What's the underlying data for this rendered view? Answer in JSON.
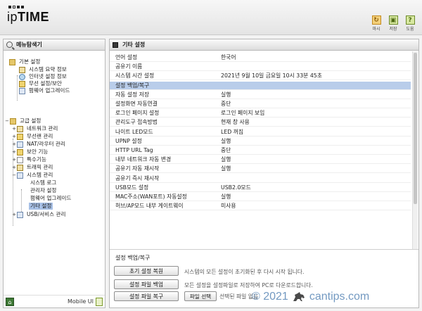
{
  "header": {
    "logo_text_ip": "ip",
    "logo_text_time": "TIME",
    "buttons": [
      {
        "label": "마시",
        "icon": "restart-icon",
        "color": "#f3d07a"
      },
      {
        "label": "저장",
        "icon": "save-icon",
        "color": "#d7e8a0"
      },
      {
        "label": "도움",
        "icon": "help-icon",
        "color": "#d7e8a0"
      }
    ]
  },
  "left": {
    "title": "메뉴탐색기",
    "tree": {
      "basic_settings": "기본 설정",
      "basic_items": [
        "시스템 요약 정보",
        "인터넷 설정 정보",
        "무선 설정/보안",
        "펌웨어 업그레이드"
      ],
      "advanced_settings": "고급 설정",
      "advanced_items": [
        "네트워크 관리",
        "무선랜 관리",
        "NAT/라우터 관리",
        "보안 기능",
        "특수기능",
        "트래픽 관리",
        "시스템 관리"
      ],
      "system_items": [
        "시스템 로그",
        "관리자 설정",
        "펌웨어 업그레이드",
        "기타 설정"
      ],
      "usb_item": "USB/서비스 관리"
    },
    "footer_label": "Mobile UI"
  },
  "right": {
    "title": "기타 설정",
    "settings": [
      {
        "key": "언어 설정",
        "value": "한국어"
      },
      {
        "key": "공유기 이름",
        "value": ""
      },
      {
        "key": "시스템 시간 설정",
        "value": "2021년 9월 10일 금요일 10시 33분 45초"
      },
      {
        "key": "설정 백업/복구",
        "value": "",
        "selected": true
      },
      {
        "key": "자동 설정 저장",
        "value": "실행"
      },
      {
        "key": "설정화면 자동연결",
        "value": "중단"
      },
      {
        "key": "로그인 페이지 설정",
        "value": "로그인 페이지 보임"
      },
      {
        "key": "관리도구 접속방법",
        "value": "현재 창 사용"
      },
      {
        "key": "나이트 LED모드",
        "value": "LED 꺼짐"
      },
      {
        "key": "UPNP 설정",
        "value": "실행"
      },
      {
        "key": "HTTP URL Tag",
        "value": "중단"
      },
      {
        "key": "내부 네트워크 자동 변경",
        "value": "실행"
      },
      {
        "key": "공유기 자동 재시작",
        "value": "실행"
      },
      {
        "key": "공유기 즉시 재시작",
        "value": ""
      },
      {
        "key": "USB모드 설정",
        "value": "USB2.0모드"
      },
      {
        "key": "MAC주소(WAN포트) 자동설정",
        "value": "실행"
      },
      {
        "key": "허브/AP모드 내부 게이트웨이",
        "value": "미사용"
      }
    ],
    "section_title": "설정 백업/복구",
    "actions": [
      {
        "label": "초기 설정 복원",
        "desc": "시스템의 모든 설정이 초기화된 후 다시 시작 됩니다."
      },
      {
        "label": "설정 파일 백업",
        "desc": "모든 설정을 설정파일로 저장하여 PC로 다운로드합니다."
      },
      {
        "label": "설정 파일 복구",
        "desc": ""
      }
    ],
    "file_button": "파일 선택",
    "file_status": "선택된 파일 없음"
  },
  "watermark": {
    "prefix": "© 2021",
    "site": "cantips.com"
  },
  "colors": {
    "selected_row": "#b9cdea",
    "tree_selected": "#a7c0e6",
    "watermark": "#5b88b7"
  }
}
